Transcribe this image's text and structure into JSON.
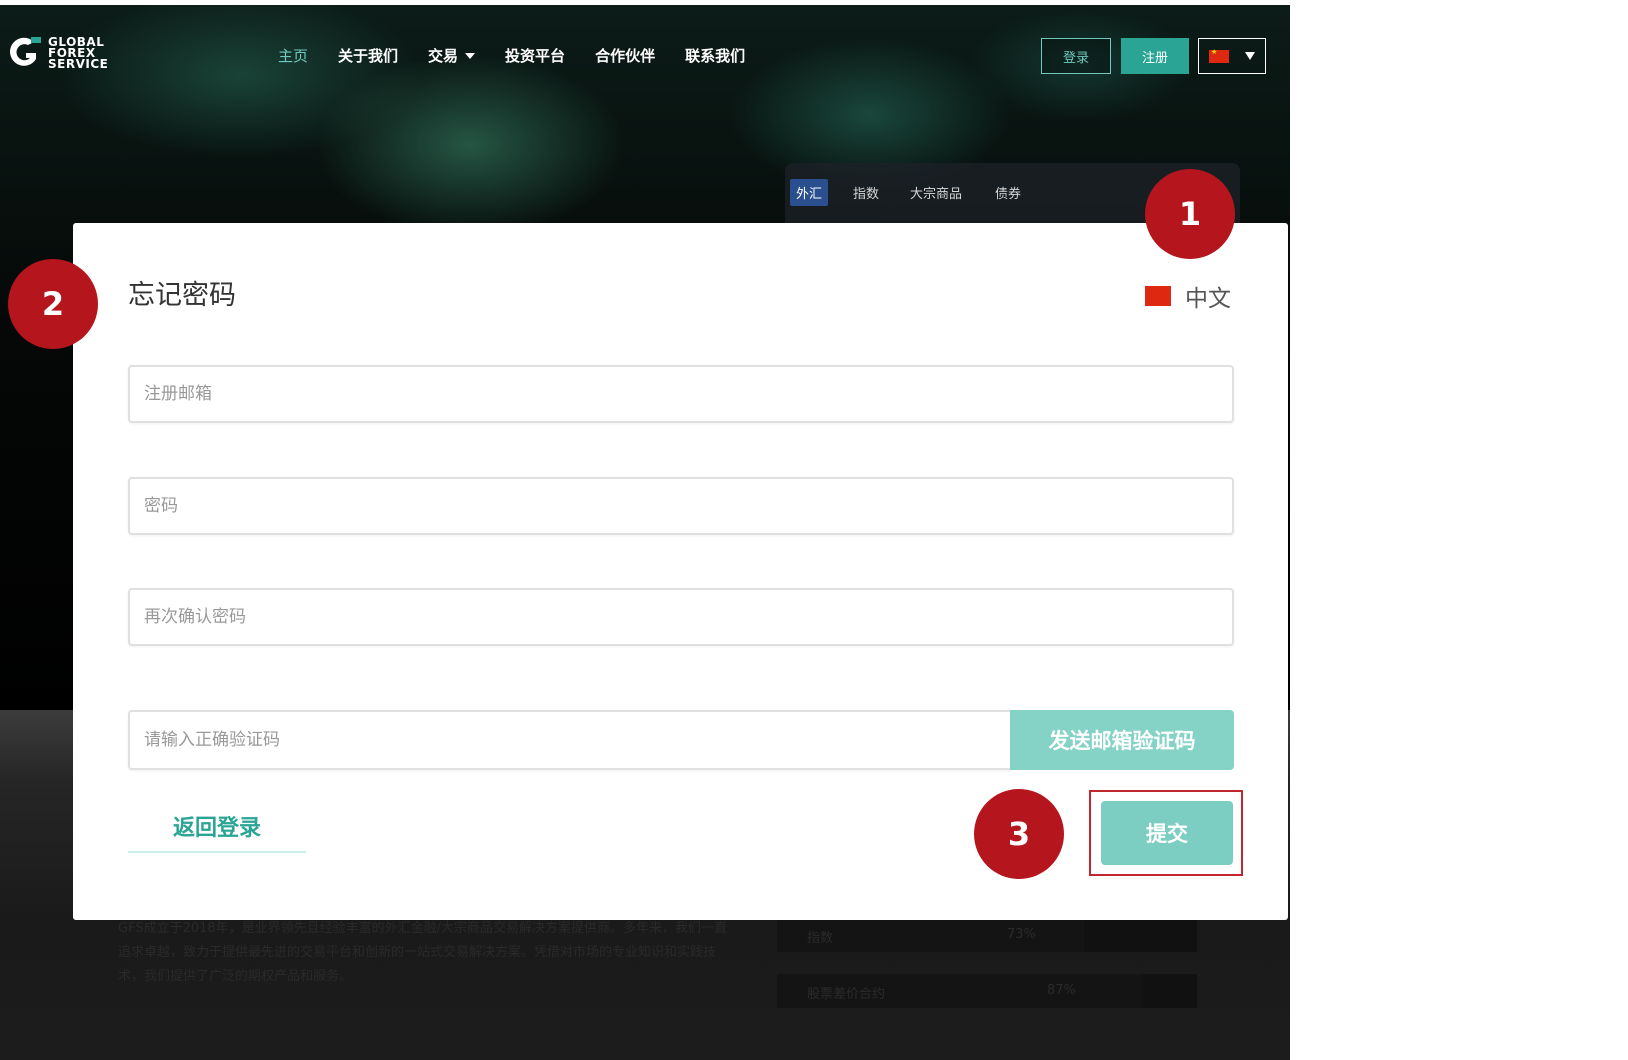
{
  "header": {
    "logo_line1": "GLOBAL",
    "logo_line2": "FOREX",
    "logo_line3": "SERVICE",
    "nav": {
      "home": "主页",
      "about": "关于我们",
      "trade": "交易",
      "platform": "投资平台",
      "partners": "合作伙伴",
      "contact": "联系我们"
    },
    "login_label": "登录",
    "register_label": "注册"
  },
  "market_tabs": {
    "forex": "外汇",
    "indices": "指数",
    "commodities": "大宗商品",
    "bonds": "债券"
  },
  "background": {
    "about_text": "GFS成立于2018年，是业界领先且经验丰富的外汇金融/大宗商品交易解决方案提供商。多年来，我们一直追求卓越，致力于提供最先进的交易平台和创新的一站式交易解决方案。凭借对市场的专业知识和实践技术，我们提供了广泛的期权产品和服务。",
    "stats": [
      {
        "label": "指数",
        "percent": "73%",
        "fraction": 0.73
      },
      {
        "label": "股票差价合约",
        "percent": "87%",
        "fraction": 0.87
      }
    ]
  },
  "modal": {
    "title": "忘记密码",
    "language_label": "中文",
    "email_placeholder": "注册邮箱",
    "password_placeholder": "密码",
    "confirm_placeholder": "再次确认密码",
    "code_placeholder": "请输入正确验证码",
    "send_code_label": "发送邮箱验证码",
    "back_to_login_label": "返回登录",
    "submit_label": "提交"
  },
  "badges": {
    "step1": "1",
    "step2": "2",
    "step3": "3"
  },
  "colors": {
    "accent_teal": "#2aa595",
    "button_teal_light": "#85d2c7",
    "badge_red": "#b5161d",
    "highlight_outline": "#c1272d",
    "active_tab_blue": "#2a4f8f"
  }
}
